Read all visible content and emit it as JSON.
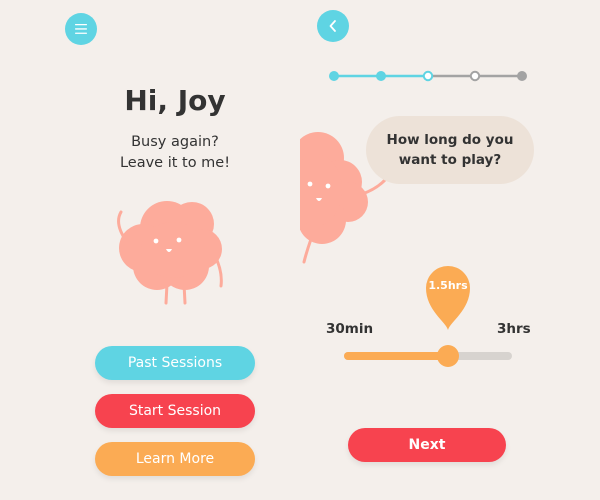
{
  "colors": {
    "background": "#f4efeb",
    "cyan": "#5fd4e3",
    "red": "#f7434f",
    "orange": "#fbab54",
    "character": "#fdab9b",
    "bubble": "#ede2d8",
    "track": "#d7d3cf",
    "text": "#333333"
  },
  "home": {
    "menu_icon": "hamburger-menu-icon",
    "greeting": "Hi, Joy",
    "subtitle_lines": [
      "Busy again?",
      "Leave it to me!"
    ],
    "buttons": {
      "past_sessions": "Past Sessions",
      "start_session": "Start Session",
      "learn_more": "Learn More"
    }
  },
  "setup": {
    "back_icon": "chevron-left-icon",
    "progress": {
      "total_steps": 5,
      "current_step": 3
    },
    "question_lines": [
      "How long do you",
      "want to play?"
    ],
    "duration": {
      "min_label": "30min",
      "max_label": "3hrs",
      "selected_label": "1.5hrs",
      "fraction": 0.62
    },
    "next_label": "Next"
  }
}
